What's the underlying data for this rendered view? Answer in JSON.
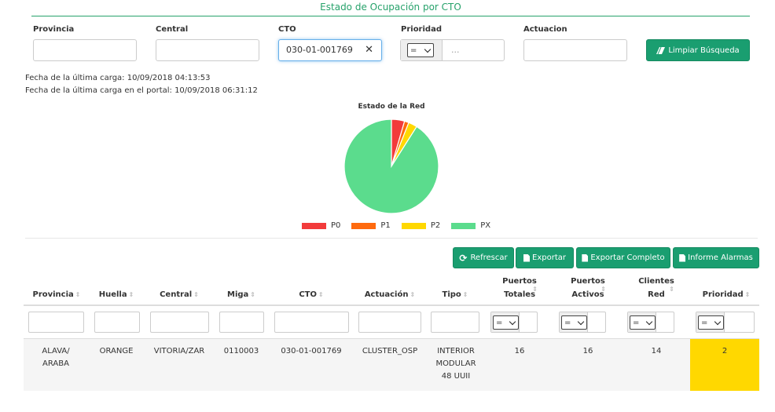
{
  "page": {
    "title": "Estado de Ocupación por CTO"
  },
  "filters": {
    "provincia": {
      "label": "Provincia",
      "value": ""
    },
    "central": {
      "label": "Central",
      "value": ""
    },
    "cto": {
      "label": "CTO",
      "value": "030-01-001769",
      "clear": "✕"
    },
    "prioridad": {
      "label": "Prioridad",
      "operator": "=",
      "placeholder": "..."
    },
    "actuacion": {
      "label": "Actuacion",
      "value": ""
    },
    "clear_button": "Limpiar Búsqueda"
  },
  "meta": {
    "last_load": "Fecha de la última carga: 10/09/2018 04:13:53",
    "last_portal_load": "Fecha de la última carga en el portal: 10/09/2018 06:31:12"
  },
  "chart_data": {
    "type": "pie",
    "title": "Estado de la Red",
    "labels": [
      "P0",
      "P1",
      "P2",
      "PX"
    ],
    "values": [
      4.5,
      1.5,
      3.0,
      91.0
    ],
    "colors": [
      "#f23b3b",
      "#ff6a0e",
      "#ffd800",
      "#5bdc8d"
    ],
    "legend": "bottom"
  },
  "toolbar": {
    "refresh": "Refrescar",
    "export": "Exportar",
    "export_full": "Exportar Completo",
    "alarms_report": "Informe Alarmas"
  },
  "table": {
    "columns": [
      "Provincia",
      "Huella",
      "Central",
      "Miga",
      "CTO",
      "Actuación",
      "Tipo",
      "Puertos Totales",
      "Puertos Activos",
      "Clientes Red",
      "Prioridad"
    ],
    "filter_operator": "=",
    "rows": [
      {
        "provincia": "ALAVA/ ARABA",
        "huella": "ORANGE",
        "central": "VITORIA/ZAR",
        "miga": "0110003",
        "cto": "030-01-001769",
        "actuacion": "CLUSTER_OSP",
        "tipo": "INTERIOR MODULAR 48 UUII",
        "puertos_totales": "16",
        "puertos_activos": "16",
        "clientes_red": "14",
        "prioridad": "2"
      }
    ]
  },
  "colors": {
    "accent": "#1a9e70",
    "title": "#27a26b",
    "priority_highlight": "#ffd800"
  }
}
